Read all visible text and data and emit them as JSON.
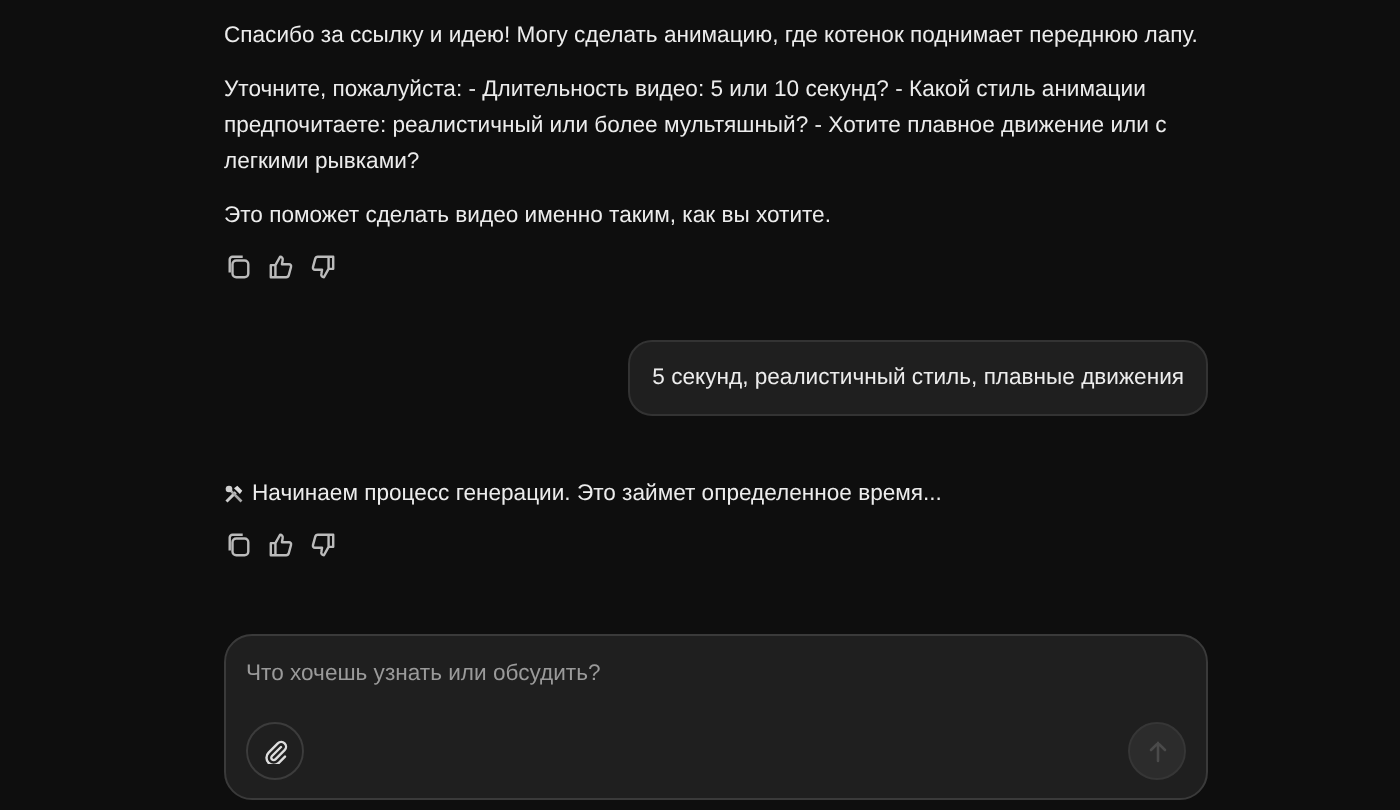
{
  "messages": [
    {
      "kind": "assistant",
      "paragraphs": [
        "Спасибо за ссылку и идею! Могу сделать анимацию, где котенок поднимает переднюю лапу.",
        "Уточните, пожалуйста: - Длительность видео: 5 или 10 секунд? - Какой стиль анимации предпочитаете: реалистичный или более мультяшный? - Хотите плавное движение или с легкими рывками?",
        "Это поможет сделать видео именно таким, как вы хотите."
      ]
    },
    {
      "kind": "user",
      "text": "5 секунд, реалистичный стиль, плавные движения"
    },
    {
      "kind": "status",
      "paragraphs": [
        "Начинаем процесс генерации. Это займет определенное время..."
      ]
    }
  ],
  "composer": {
    "placeholder": "Что хочешь узнать или обсудить?",
    "send_disabled": true
  }
}
